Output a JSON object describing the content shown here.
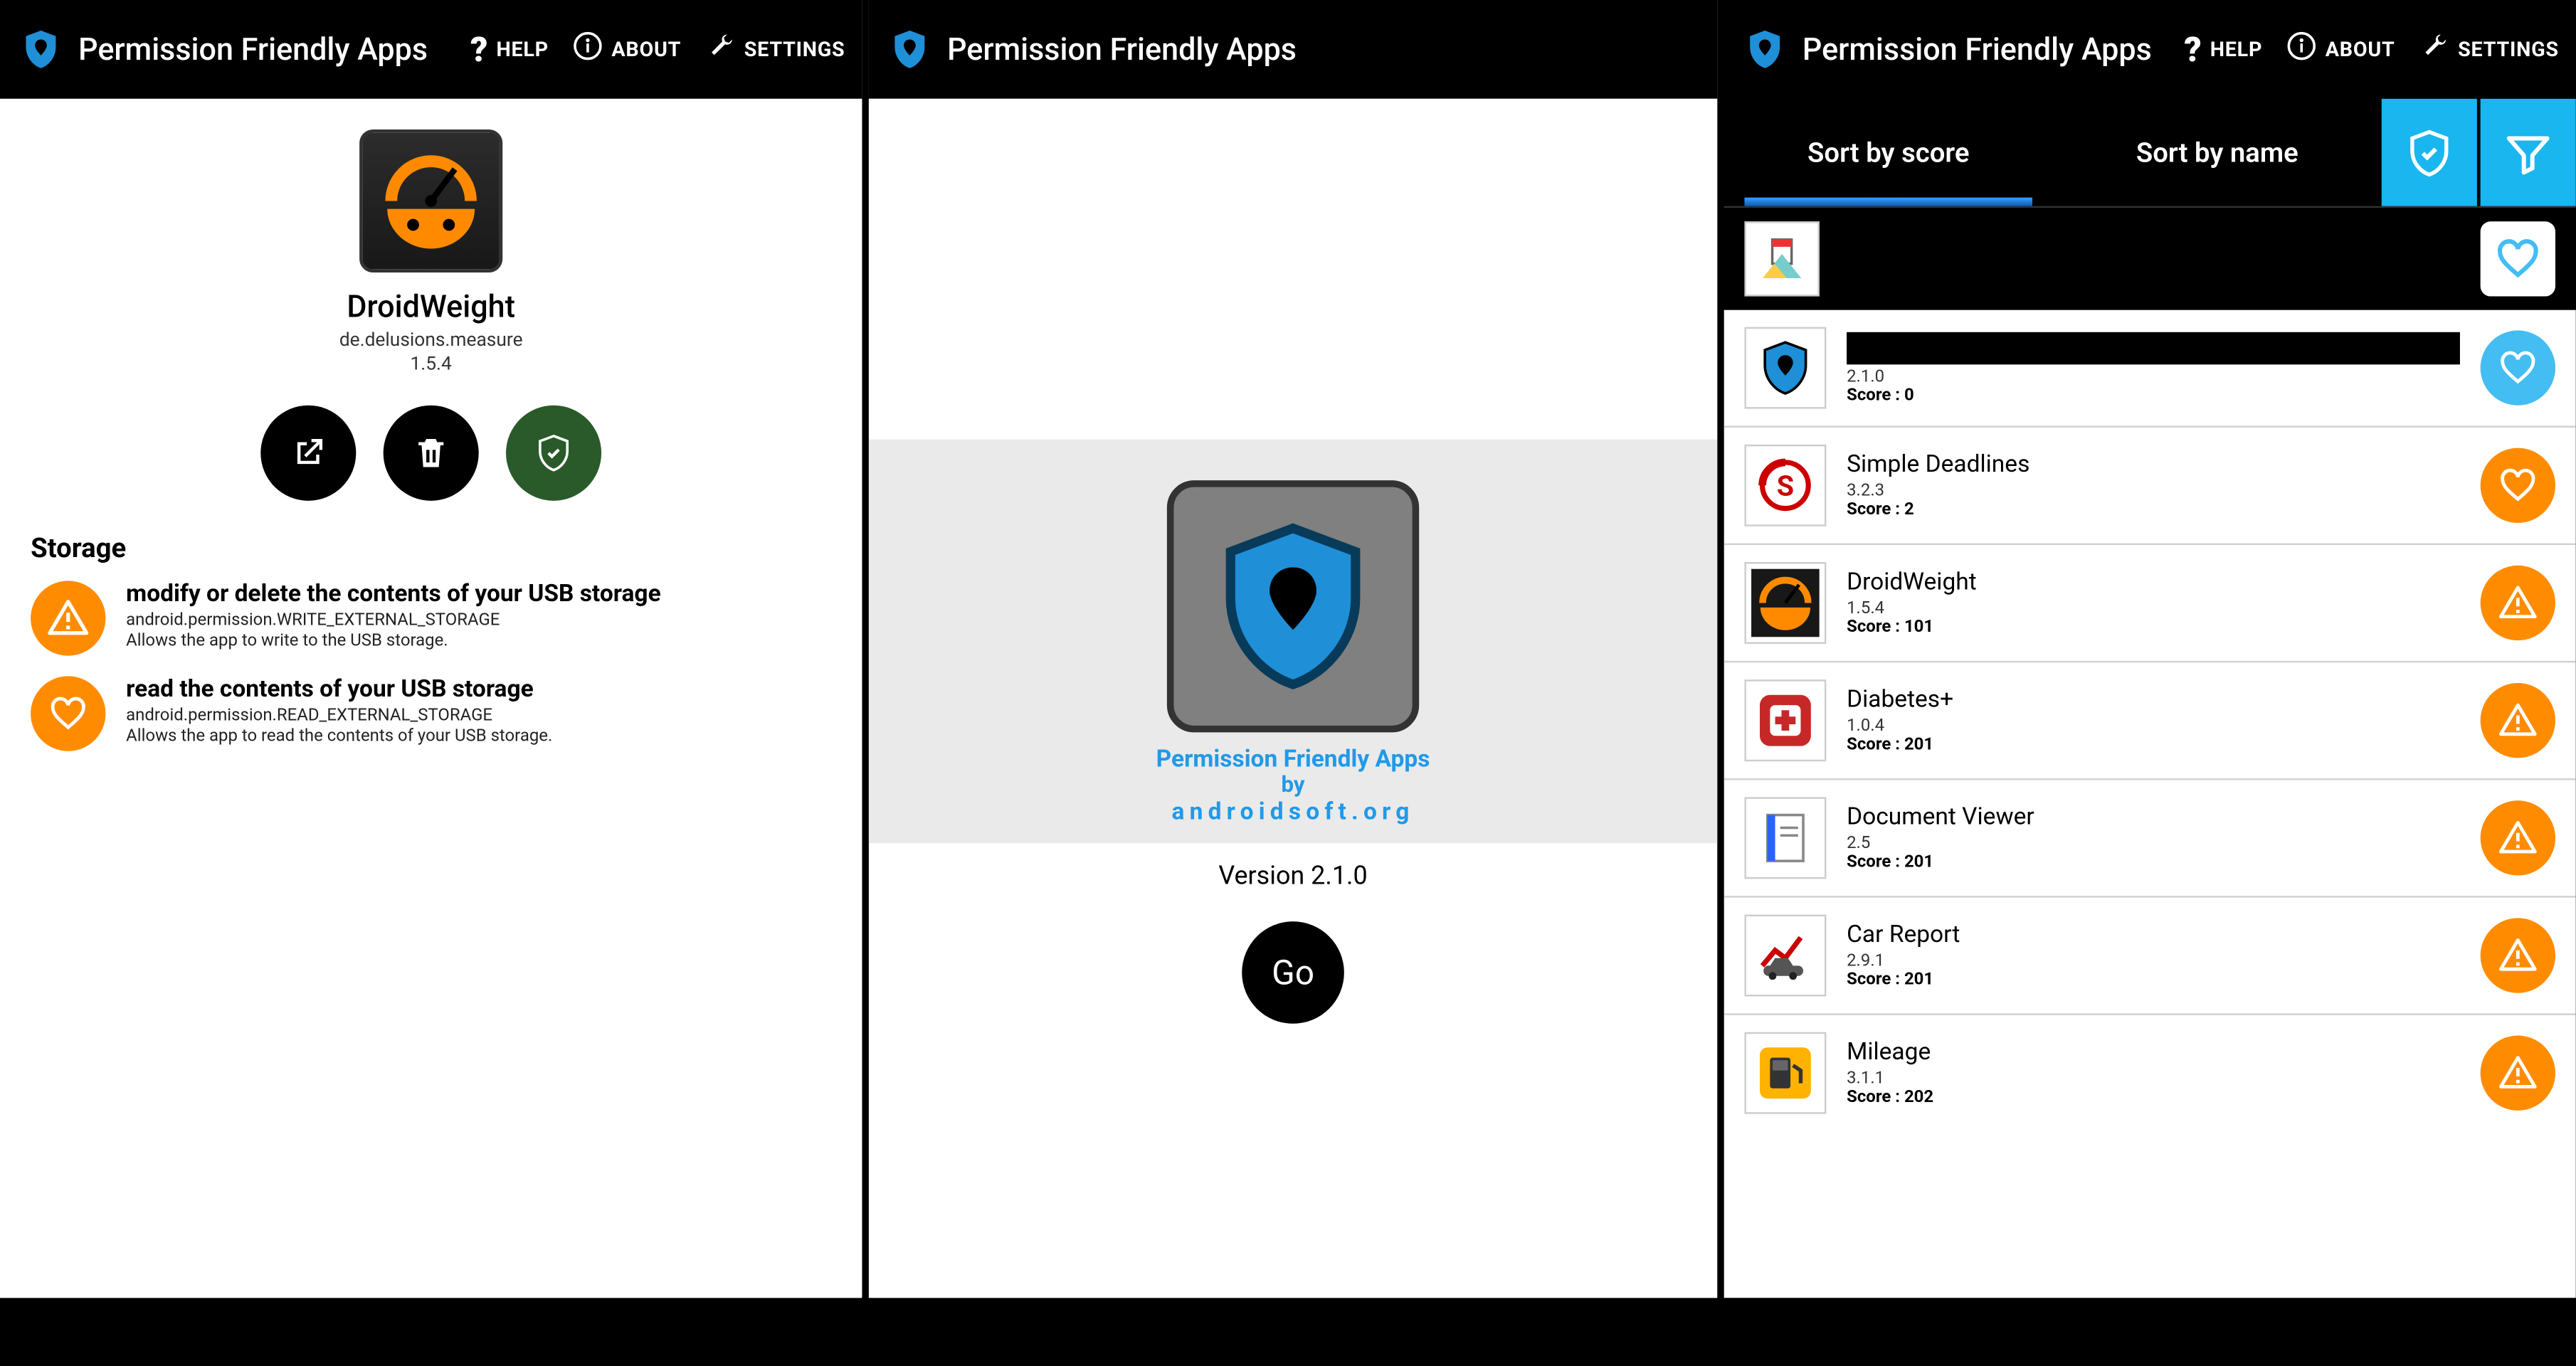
{
  "actionbar": {
    "title": "Permission Friendly Apps",
    "help": "HELP",
    "about": "ABOUT",
    "settings": "SETTINGS"
  },
  "detail": {
    "app_name": "DroidWeight",
    "package": "de.delusions.measure",
    "version": "1.5.4",
    "section": "Storage",
    "perms": [
      {
        "badge": "warning",
        "title": "modify or delete the contents of your USB storage",
        "id": "android.permission.WRITE_EXTERNAL_STORAGE",
        "desc": "Allows the app to write to the USB storage."
      },
      {
        "badge": "heart",
        "title": "read the contents of your USB storage",
        "id": "android.permission.READ_EXTERNAL_STORAGE",
        "desc": "Allows the app to read the contents of your USB storage."
      }
    ]
  },
  "about": {
    "line1": "Permission Friendly Apps",
    "line2": "by",
    "line3": "androidsoft.org",
    "version_label": "Version 2.1.0",
    "go_label": "Go"
  },
  "list": {
    "tab1": "Sort by score",
    "tab2": "Sort by name",
    "score_prefix": "Score : ",
    "items": [
      {
        "name": "",
        "version": "2.1.0",
        "score": "0",
        "badge": "heart-blue",
        "black_name": true,
        "icon": "shield"
      },
      {
        "name": "Simple Deadlines",
        "version": "3.2.3",
        "score": "2",
        "badge": "heart-orange",
        "icon": "deadlines"
      },
      {
        "name": "DroidWeight",
        "version": "1.5.4",
        "score": "101",
        "badge": "warning-orange",
        "icon": "droidweight"
      },
      {
        "name": "Diabetes+",
        "version": "1.0.4",
        "score": "201",
        "badge": "warning-orange",
        "icon": "diabetes"
      },
      {
        "name": "Document Viewer",
        "version": "2.5",
        "score": "201",
        "badge": "warning-orange",
        "icon": "docviewer"
      },
      {
        "name": "Car Report",
        "version": "2.9.1",
        "score": "201",
        "badge": "warning-orange",
        "icon": "carreport"
      },
      {
        "name": "Mileage",
        "version": "3.1.1",
        "score": "202",
        "badge": "warning-orange",
        "icon": "mileage"
      }
    ]
  }
}
